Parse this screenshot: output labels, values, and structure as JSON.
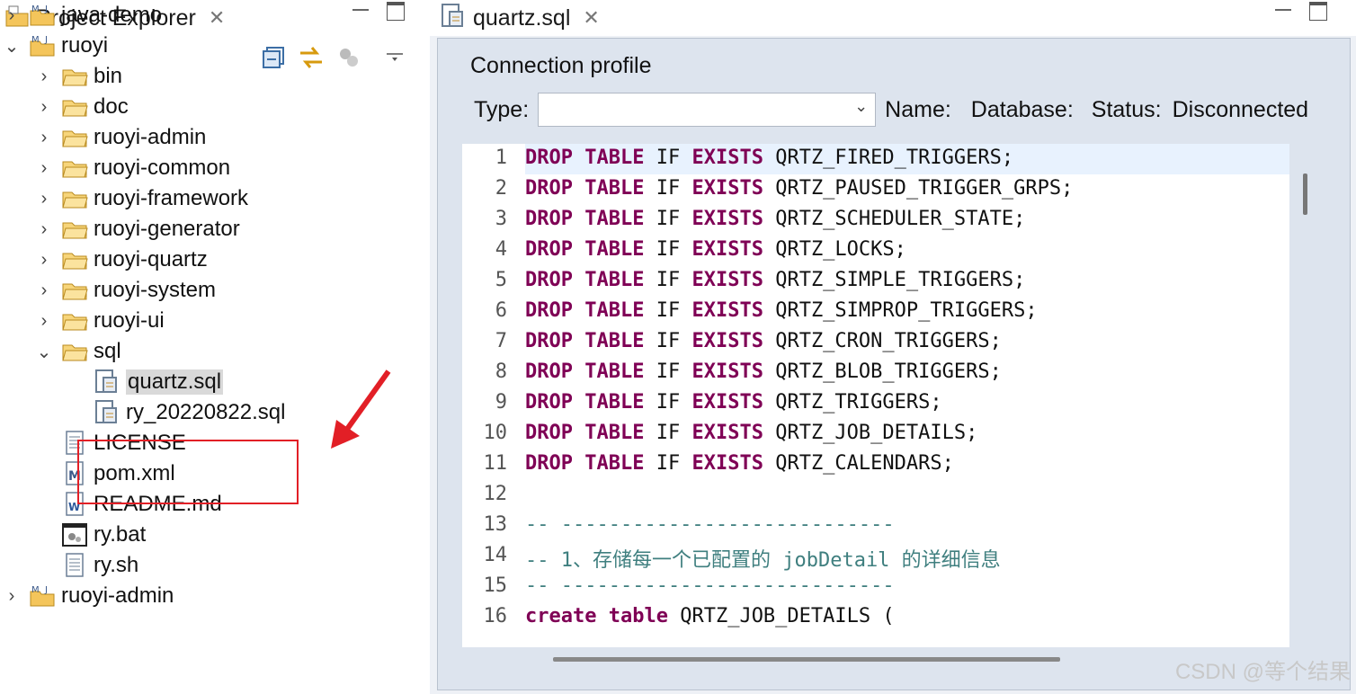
{
  "project_explorer": {
    "tab_label": "Project Explorer",
    "tree": [
      {
        "label": "java-demo",
        "icon": "project-icon",
        "chevron": "›"
      },
      {
        "label": "ruoyi",
        "icon": "project-icon",
        "chevron": "⌄"
      },
      {
        "label": "bin",
        "icon": "folder-icon",
        "chevron": "›"
      },
      {
        "label": "doc",
        "icon": "folder-icon",
        "chevron": "›"
      },
      {
        "label": "ruoyi-admin",
        "icon": "folder-icon",
        "chevron": "›"
      },
      {
        "label": "ruoyi-common",
        "icon": "folder-icon",
        "chevron": "›"
      },
      {
        "label": "ruoyi-framework",
        "icon": "folder-icon",
        "chevron": "›"
      },
      {
        "label": "ruoyi-generator",
        "icon": "folder-icon",
        "chevron": "›"
      },
      {
        "label": "ruoyi-quartz",
        "icon": "folder-icon",
        "chevron": "›"
      },
      {
        "label": "ruoyi-system",
        "icon": "folder-icon",
        "chevron": "›"
      },
      {
        "label": "ruoyi-ui",
        "icon": "folder-icon",
        "chevron": "›"
      },
      {
        "label": "sql",
        "icon": "folder-icon",
        "chevron": "⌄"
      },
      {
        "label": "quartz.sql",
        "icon": "sql-file-icon",
        "chevron": ""
      },
      {
        "label": "ry_20220822.sql",
        "icon": "sql-file-icon",
        "chevron": ""
      },
      {
        "label": "LICENSE",
        "icon": "text-file-icon",
        "chevron": ""
      },
      {
        "label": "pom.xml",
        "icon": "maven-file-icon",
        "chevron": ""
      },
      {
        "label": "README.md",
        "icon": "word-file-icon",
        "chevron": ""
      },
      {
        "label": "ry.bat",
        "icon": "batch-file-icon",
        "chevron": ""
      },
      {
        "label": "ry.sh",
        "icon": "text-file-icon",
        "chevron": ""
      },
      {
        "label": "ruoyi-admin",
        "icon": "project-icon",
        "chevron": "›"
      }
    ]
  },
  "editor": {
    "tab_label": "quartz.sql",
    "connection_profile": {
      "title": "Connection profile",
      "type_label": "Type:",
      "type_value": "",
      "name_label": "Name:",
      "database_label": "Database:",
      "status_label": "Status:",
      "status_value": "Disconnected"
    },
    "lines": [
      {
        "n": "1",
        "code": "DROP TABLE IF EXISTS QRTZ_FIRED_TRIGGERS;"
      },
      {
        "n": "2",
        "code": "DROP TABLE IF EXISTS QRTZ_PAUSED_TRIGGER_GRPS;"
      },
      {
        "n": "3",
        "code": "DROP TABLE IF EXISTS QRTZ_SCHEDULER_STATE;"
      },
      {
        "n": "4",
        "code": "DROP TABLE IF EXISTS QRTZ_LOCKS;"
      },
      {
        "n": "5",
        "code": "DROP TABLE IF EXISTS QRTZ_SIMPLE_TRIGGERS;"
      },
      {
        "n": "6",
        "code": "DROP TABLE IF EXISTS QRTZ_SIMPROP_TRIGGERS;"
      },
      {
        "n": "7",
        "code": "DROP TABLE IF EXISTS QRTZ_CRON_TRIGGERS;"
      },
      {
        "n": "8",
        "code": "DROP TABLE IF EXISTS QRTZ_BLOB_TRIGGERS;"
      },
      {
        "n": "9",
        "code": "DROP TABLE IF EXISTS QRTZ_TRIGGERS;"
      },
      {
        "n": "10",
        "code": "DROP TABLE IF EXISTS QRTZ_JOB_DETAILS;"
      },
      {
        "n": "11",
        "code": "DROP TABLE IF EXISTS QRTZ_CALENDARS;"
      },
      {
        "n": "12",
        "code": ""
      },
      {
        "n": "13",
        "code": "-- ----------------------------"
      },
      {
        "n": "14",
        "code": "-- 1、存储每一个已配置的 jobDetail 的详细信息"
      },
      {
        "n": "15",
        "code": "-- ----------------------------"
      },
      {
        "n": "16",
        "code": "create table QRTZ_JOB_DETAILS ("
      }
    ]
  },
  "watermark": "CSDN @等个结果"
}
